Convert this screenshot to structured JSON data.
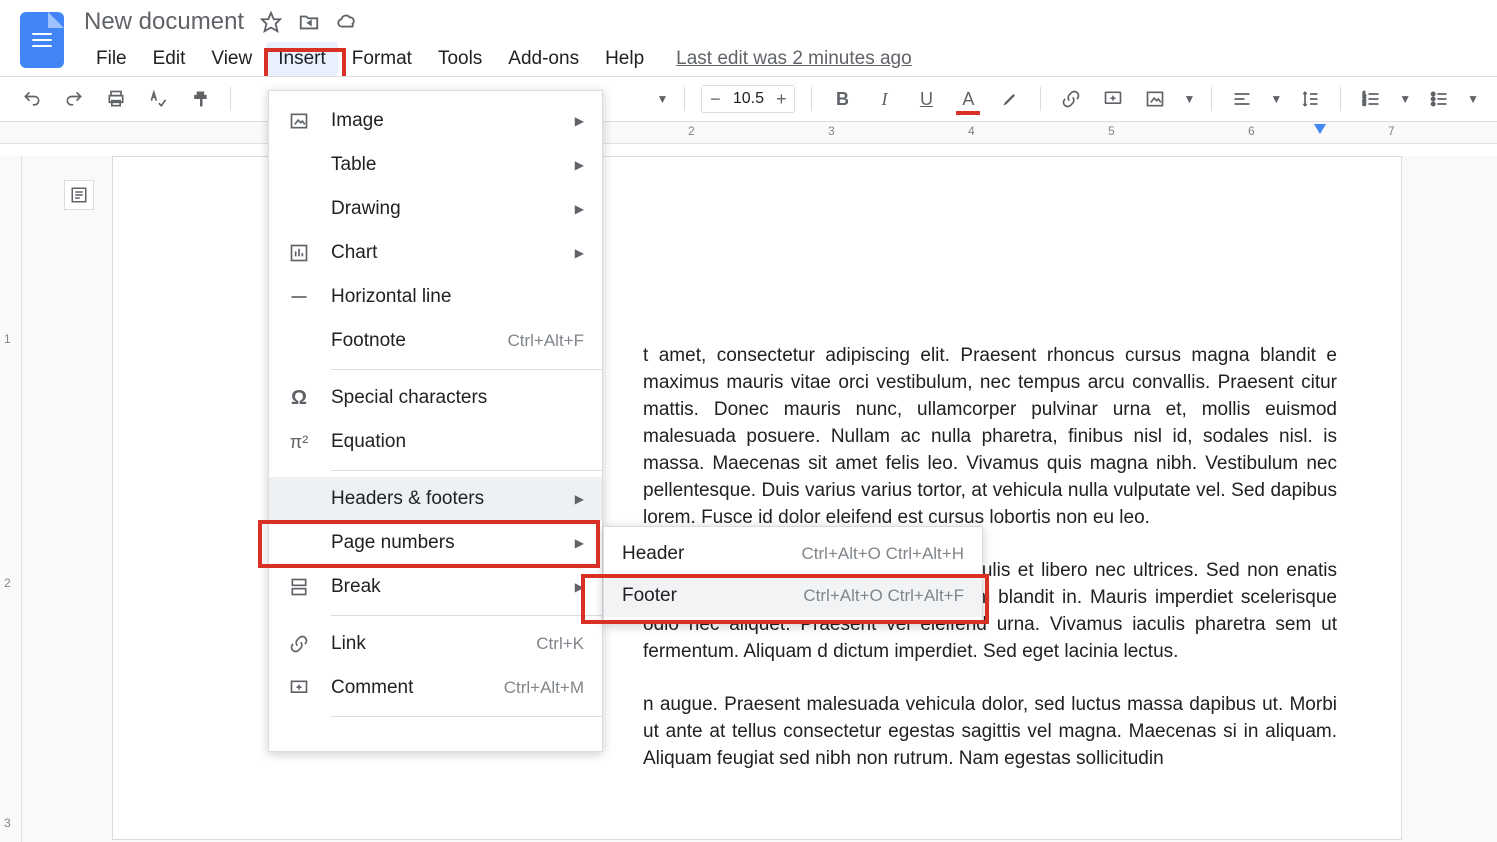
{
  "doc": {
    "title": "New document",
    "last_edit": "Last edit was 2 minutes ago"
  },
  "menus": {
    "file": "File",
    "edit": "Edit",
    "view": "View",
    "insert": "Insert",
    "format": "Format",
    "tools": "Tools",
    "addons": "Add-ons",
    "help": "Help"
  },
  "toolbar": {
    "fontsize": "10.5"
  },
  "ruler": {
    "h": [
      "2",
      "3",
      "4",
      "5",
      "6",
      "7"
    ],
    "v": [
      "1",
      "2",
      "3"
    ]
  },
  "insert_menu": {
    "image": "Image",
    "table": "Table",
    "drawing": "Drawing",
    "chart": "Chart",
    "hline": "Horizontal line",
    "footnote": "Footnote",
    "footnote_sc": "Ctrl+Alt+F",
    "special": "Special characters",
    "equation": "Equation",
    "headers": "Headers & footers",
    "pagenum": "Page numbers",
    "break": "Break",
    "link": "Link",
    "link_sc": "Ctrl+K",
    "comment": "Comment",
    "comment_sc": "Ctrl+Alt+M"
  },
  "submenu": {
    "header": "Header",
    "header_sc": "Ctrl+Alt+O Ctrl+Alt+H",
    "footer": "Footer",
    "footer_sc": "Ctrl+Alt+O Ctrl+Alt+F"
  },
  "body": {
    "p1": "t amet, consectetur adipiscing elit. Praesent rhoncus cursus magna blandit e maximus mauris vitae orci vestibulum, nec tempus arcu convallis. Praesent citur mattis. Donec mauris nunc, ullamcorper pulvinar urna et, mollis euismod malesuada posuere. Nullam ac nulla pharetra, finibus nisl id, sodales nisl. is massa. Maecenas sit amet felis leo. Vivamus quis magna nibh. Vestibulum nec pellentesque. Duis varius varius tortor, at vehicula nulla vulputate vel. Sed dapibus lorem. Fusce id dolor eleifend est cursus lobortis non eu leo.",
    "p2": "ces posuere cubilia curae; Vivamus iaculis et libero nec ultrices. Sed non enatis placerat. Vestibulum dapibus nentum mi blandit in. Mauris imperdiet scelerisque odio nec aliquet. Praesent vel eleifend urna. Vivamus iaculis pharetra sem ut fermentum. Aliquam d dictum imperdiet. Sed eget lacinia lectus.",
    "p3": "n augue. Praesent malesuada vehicula dolor, sed luctus massa dapibus ut. Morbi ut ante at tellus consectetur egestas sagittis vel magna. Maecenas si in aliquam. Aliquam feugiat sed nibh non rutrum. Nam egestas sollicitudin"
  }
}
